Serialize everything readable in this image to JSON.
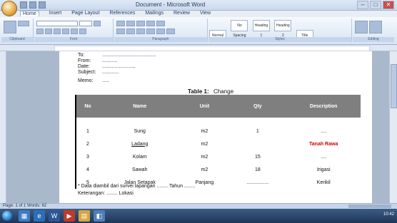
{
  "window": {
    "title": "Document - Microsoft Word",
    "controls": [
      "–",
      "□",
      "✕"
    ]
  },
  "ribbon": {
    "tabs": [
      "Home",
      "Insert",
      "Page Layout",
      "References",
      "Mailings",
      "Review",
      "View"
    ],
    "groups": [
      "Clipboard",
      "Font",
      "Paragraph",
      "Styles",
      "Editing"
    ],
    "styles": [
      "Normal",
      "No Spacing",
      "Heading 1",
      "Heading 2",
      "Title"
    ]
  },
  "document": {
    "header_lines": [
      {
        "key": "To:",
        "value": "......................................."
      },
      {
        "key": "From:",
        "value": "..........."
      },
      {
        "key": "Date:",
        "value": "........................"
      },
      {
        "key": "Subject:",
        "value": "............"
      },
      {
        "key": "Memo:",
        "value": "....."
      }
    ],
    "caption_bold": "Table 1:",
    "caption_text": "Change",
    "table": {
      "headers": [
        "No",
        "Name",
        "Unit",
        "Qty",
        "Description"
      ],
      "rows": [
        {
          "no": "1",
          "name": "Sung",
          "unit": "m2",
          "qty": "1",
          "desc": "....",
          "desc_red": false
        },
        {
          "no": "2",
          "name": "Ladang",
          "unit": "m2",
          "qty": "",
          "desc": "Tanah Rawa",
          "desc_red": true
        },
        {
          "no": "3",
          "name": "Kolam",
          "unit": "m2",
          "qty": "15",
          "desc": "....",
          "desc_red": false
        },
        {
          "no": "4",
          "name": "Sawah",
          "unit": "m2",
          "qty": "18",
          "desc": "Irigasi",
          "desc_red": false
        },
        {
          "no": "5",
          "name": "Jalan Setapak",
          "unit": "Panjang",
          "qty": "................",
          "desc": "Kerikil",
          "desc_red": false
        }
      ]
    },
    "footer_lines": [
      "* Data diambil dari survei lapangan ........ Tahun ........",
      "Keterangan: ........ Lokasi"
    ]
  },
  "statusbar": {
    "text": "Page: 1 of 1   Words: 62"
  },
  "taskbar": {
    "apps": [
      "explorer",
      "ie",
      "word",
      "media",
      "folder",
      "office"
    ],
    "clock": "10:42"
  }
}
